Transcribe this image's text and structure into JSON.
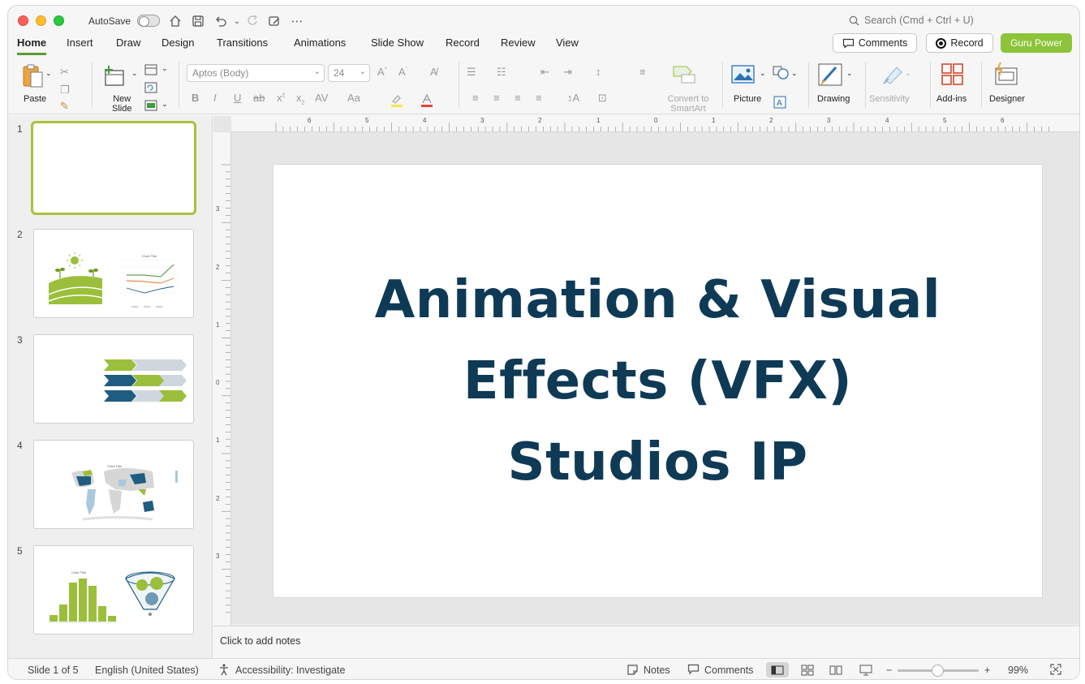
{
  "titlebar": {
    "autosave_label": "AutoSave",
    "search_placeholder": "Search (Cmd + Ctrl + U)"
  },
  "menu": {
    "tabs": [
      "Home",
      "Insert",
      "Draw",
      "Design",
      "Transitions",
      "Animations",
      "Slide Show",
      "Record",
      "Review",
      "View"
    ],
    "active": "Home",
    "comments_label": "Comments",
    "record_label": "Record",
    "guru_label": "Guru Power"
  },
  "ribbon": {
    "paste": "Paste",
    "new_slide_line1": "New",
    "new_slide_line2": "Slide",
    "font_name": "Aptos (Body)",
    "font_size": "24",
    "convert_line1": "Convert to",
    "convert_line2": "SmartArt",
    "picture": "Picture",
    "drawing": "Drawing",
    "sensitivity": "Sensitivity",
    "addins": "Add-ins",
    "designer": "Designer"
  },
  "thumbnails": {
    "numbers": [
      "1",
      "2",
      "3",
      "4",
      "5"
    ],
    "slide2_chart_title": "Chart Title",
    "slide4_chart_title": "Chart Title",
    "slide5_chart_title": "Chart Title"
  },
  "ruler": {
    "top_labels": [
      "6",
      "5",
      "4",
      "3",
      "2",
      "1",
      "0",
      "1",
      "2",
      "3",
      "4",
      "5",
      "6"
    ],
    "left_labels": [
      "3",
      "2",
      "1",
      "0",
      "1",
      "2",
      "3"
    ]
  },
  "slide": {
    "title_line1": "Animation & Visual",
    "title_line2": "Effects (VFX)",
    "title_line3": "Studios IP",
    "title_color": "#0e3a56"
  },
  "notes": {
    "placeholder": "Click to add notes"
  },
  "status": {
    "slide_counter": "Slide 1 of 5",
    "language": "English (United States)",
    "accessibility": "Accessibility: Investigate",
    "notes_label": "Notes",
    "comments_label": "Comments",
    "zoom_value": "99%"
  },
  "colors": {
    "accent_green": "#8cc43a",
    "thumb_green": "#9bbf3a",
    "thumb_blue": "#1f5d80",
    "thumb_gray": "#cfd6de"
  }
}
